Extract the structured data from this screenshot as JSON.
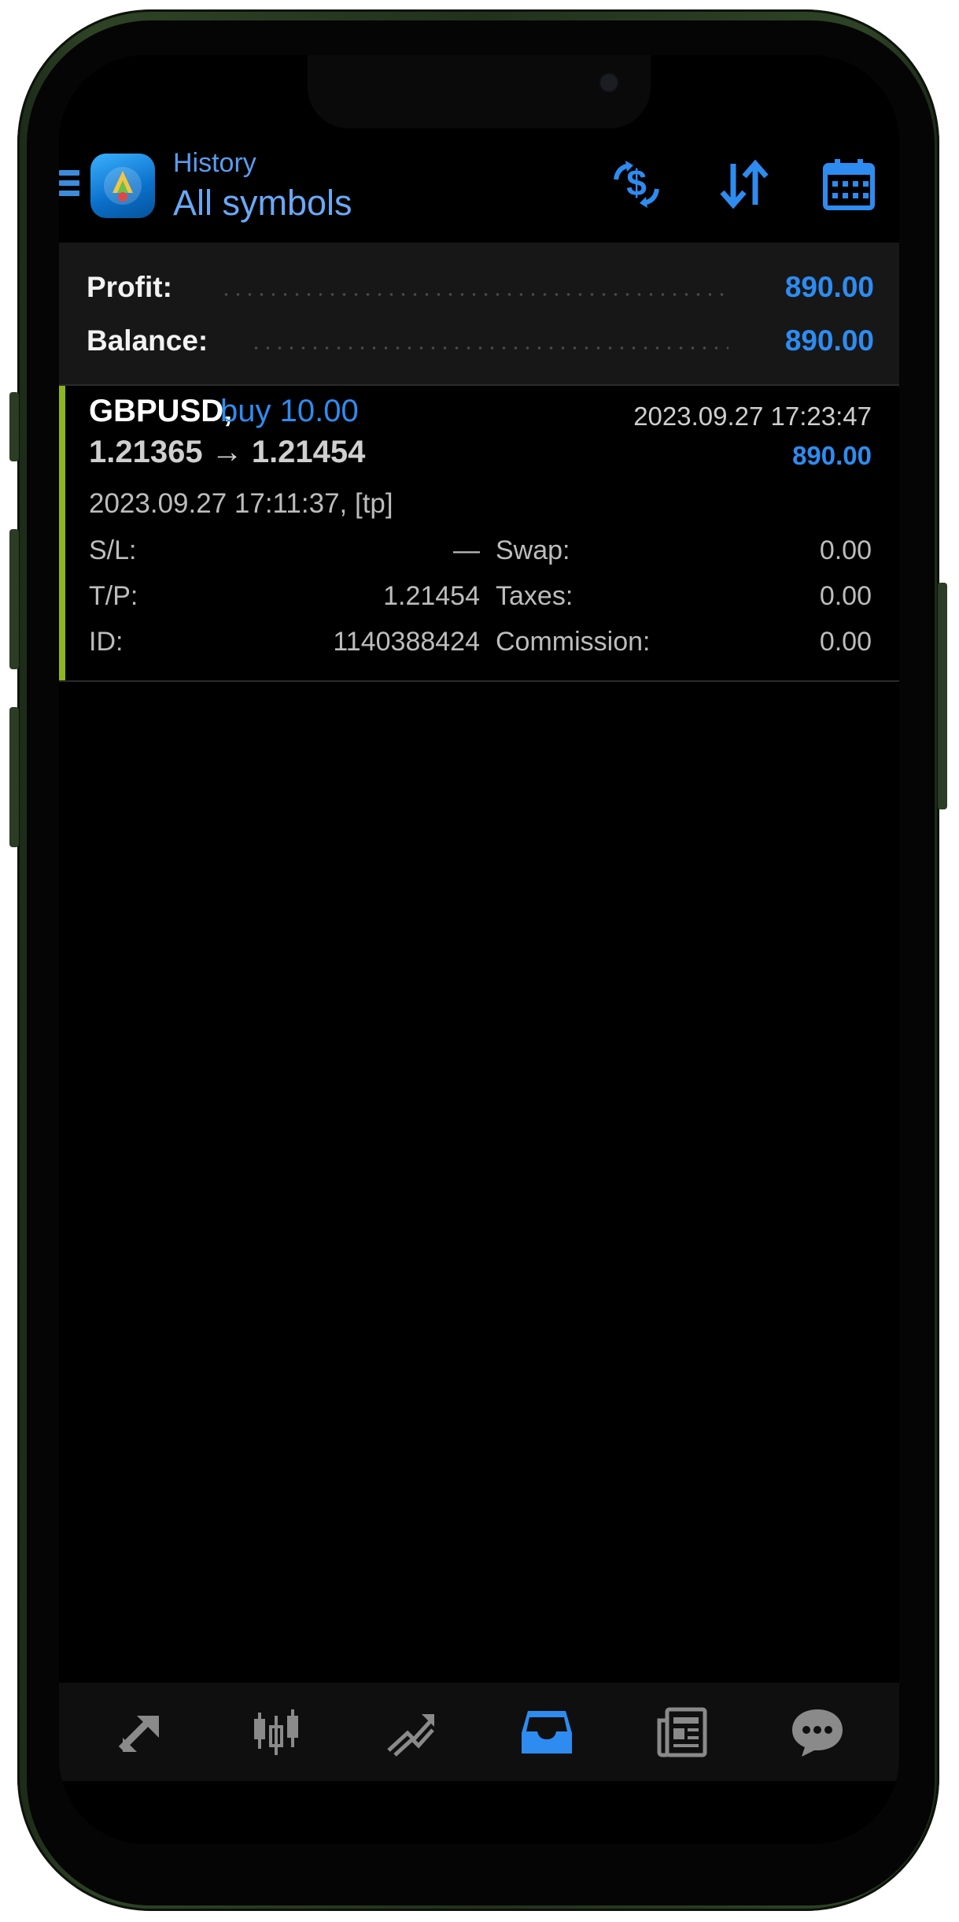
{
  "header": {
    "subtitle": "History",
    "title": "All symbols",
    "icons": [
      "menu-icon",
      "app-logo",
      "currency-exchange-icon",
      "sort-icon",
      "calendar-icon"
    ]
  },
  "summary": {
    "profit_label": "Profit:",
    "profit_value": "890.00",
    "balance_label": "Balance:",
    "balance_value": "890.00"
  },
  "deal": {
    "symbol": "GBPUSD,",
    "direction": "buy 10.00",
    "close_time": "2023.09.27 17:23:47",
    "prices": "1.21365 → 1.21454",
    "profit": "890.00",
    "open_info": "2023.09.27 17:11:37, [tp]",
    "sl_label": "S/L:",
    "sl_value": "—",
    "tp_label": "T/P:",
    "tp_value": "1.21454",
    "id_label": "ID:",
    "id_value": "1140388424",
    "swap_label": "Swap:",
    "swap_value": "0.00",
    "taxes_label": "Taxes:",
    "taxes_value": "0.00",
    "commission_label": "Commission:",
    "commission_value": "0.00"
  },
  "bottom_nav": {
    "items": [
      "quotes-icon",
      "chart-icon",
      "trade-icon",
      "history-icon",
      "news-icon",
      "messages-icon"
    ],
    "active": "history-icon"
  },
  "colors": {
    "accent": "#2e8cf0",
    "buy_bar": "#8cb51f",
    "background": "#000000",
    "panel": "#171717"
  }
}
